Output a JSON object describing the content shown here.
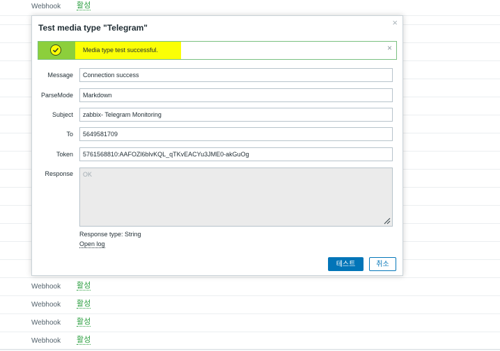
{
  "background_table": {
    "rows": [
      {
        "type": "Webhook",
        "status": "활성"
      },
      {
        "type": "Webhook",
        "status": "활성"
      },
      {
        "type": "Webhook",
        "status": "활성"
      },
      {
        "type": "Webhook",
        "status": "활성"
      },
      {
        "type": "Webhook",
        "status": "활성"
      }
    ]
  },
  "dialog": {
    "title": "Test media type \"Telegram\"",
    "close_icon": "×",
    "message": {
      "text": "Media type test successful.",
      "icon": "check-circle-icon",
      "close_icon": "×"
    },
    "fields": {
      "message": {
        "label": "Message",
        "value": "Connection success"
      },
      "parse_mode": {
        "label": "ParseMode",
        "value": "Markdown"
      },
      "subject": {
        "label": "Subject",
        "value": "zabbix- Telegram Monitoring"
      },
      "to": {
        "label": "To",
        "value": "5649581709"
      },
      "token": {
        "label": "Token",
        "value": "5761568810:AAFOZl6blvKQL_qTKvEACYu3JME0-akGuOg"
      }
    },
    "response": {
      "label": "Response",
      "value": "OK",
      "type_text": "Response type: String",
      "open_log": "Open log"
    },
    "buttons": {
      "test": "테스트",
      "cancel": "취소"
    }
  },
  "colors": {
    "primary": "#0275b8",
    "success_border": "#79c07f",
    "highlight": "#fbff06",
    "icon_bg": "#8ccf3c",
    "status_green": "#2a9e3f"
  }
}
